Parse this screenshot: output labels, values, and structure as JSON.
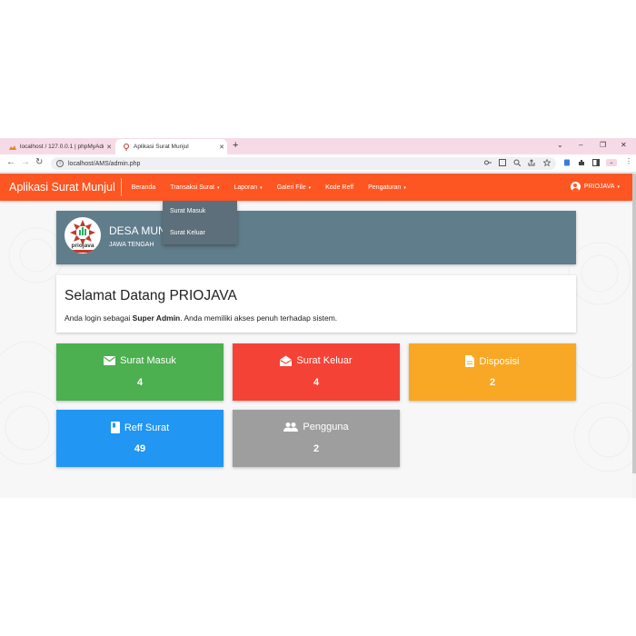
{
  "browser": {
    "tabs": [
      {
        "label": "localhost / 127.0.0.1 | phpMyAdm",
        "close": "✕"
      },
      {
        "label": "Aplikasi Surat Munjul",
        "close": "✕"
      }
    ],
    "new_tab": "+",
    "url": "localhost/AMS/admin.php"
  },
  "navbar": {
    "brand": "Aplikasi Surat Munjul",
    "menu": [
      {
        "label": "Beranda",
        "caret": ""
      },
      {
        "label": "Transaksi Surat",
        "caret": "▾"
      },
      {
        "label": "Laporan",
        "caret": "▾"
      },
      {
        "label": "Galeri File",
        "caret": "▾"
      },
      {
        "label": "Kode Reff",
        "caret": ""
      },
      {
        "label": "Pengaturan",
        "caret": "▾"
      }
    ],
    "user": "PRIOJAVA",
    "user_caret": "▾",
    "accent": "#fd5623"
  },
  "dropdown": {
    "items": [
      "Surat Masuk",
      "Surat Keluar"
    ]
  },
  "header": {
    "logo_text": "priojava",
    "name": "DESA MUN",
    "province": "JAWA TENGAH"
  },
  "welcome": {
    "title": "Selamat Datang PRIOJAVA",
    "text_before": "Anda login sebagai ",
    "role": "Super Admin",
    "text_after": ". Anda memiliki akses penuh terhadap sistem."
  },
  "stats": [
    {
      "label": "Surat Masuk",
      "value": "4",
      "icon": "mail-icon",
      "color": "#4caf50"
    },
    {
      "label": "Surat Keluar",
      "value": "4",
      "icon": "mail-open-icon",
      "color": "#f44336"
    },
    {
      "label": "Disposisi",
      "value": "2",
      "icon": "document-icon",
      "color": "#f9a825"
    },
    {
      "label": "Reff Surat",
      "value": "49",
      "icon": "book-icon",
      "color": "#2196f3"
    },
    {
      "label": "Pengguna",
      "value": "2",
      "icon": "users-icon",
      "color": "#9e9e9e"
    }
  ]
}
